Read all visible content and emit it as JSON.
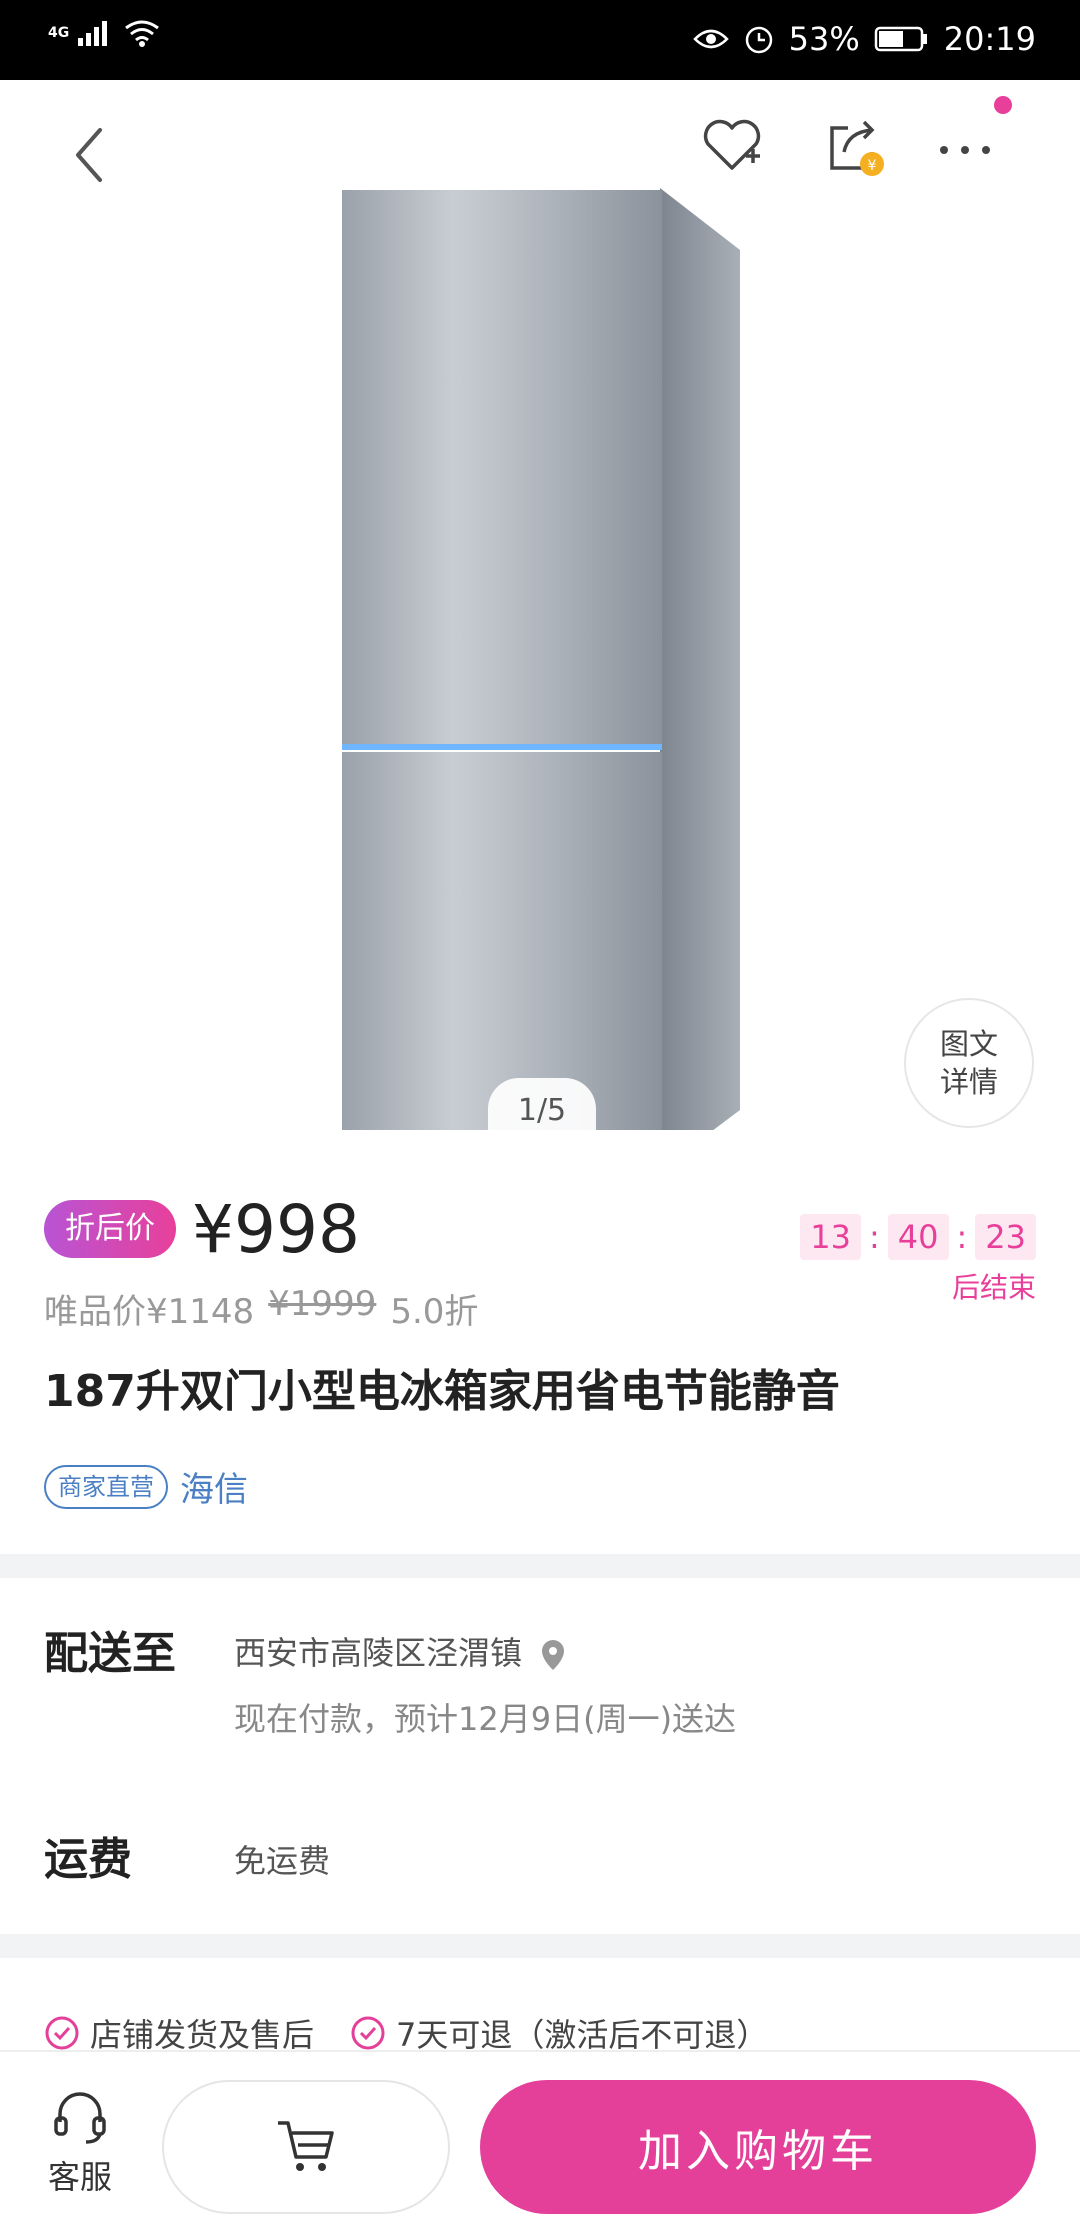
{
  "status_bar": {
    "network": "4G",
    "battery": "53%",
    "time": "20:19"
  },
  "gallery": {
    "pager": "1/5",
    "detail_badge_line1": "图文",
    "detail_badge_line2": "详情"
  },
  "price": {
    "tag": "折后价",
    "current": "¥998",
    "vip_price": "唯品价¥1148",
    "original": "¥1999",
    "discount": "5.0折"
  },
  "countdown": {
    "hours": "13",
    "minutes": "40",
    "seconds": "23",
    "separator": ":",
    "suffix": "后结束"
  },
  "product": {
    "title": "187升双门小型电冰箱家用省电节能静音",
    "store_badge": "商家直营",
    "brand": "海信"
  },
  "delivery": {
    "label": "配送至",
    "address": "西安市高陵区泾渭镇",
    "estimate": "现在付款，预计12月9日(周一)送达"
  },
  "shipping": {
    "label": "运费",
    "value": "免运费"
  },
  "promises": [
    "店铺发货及售后",
    "7天可退（激活后不可退）"
  ],
  "bottom_bar": {
    "service_label": "客服",
    "add_to_cart_label": "加入购物车"
  },
  "colors": {
    "accent": "#e4409a",
    "link": "#4a7fc4"
  }
}
